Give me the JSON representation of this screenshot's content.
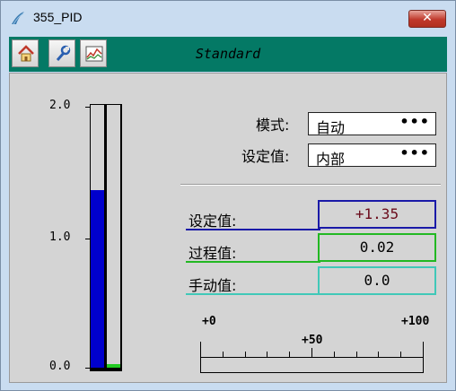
{
  "window": {
    "title": "355_PID",
    "close_label": "✕"
  },
  "toolbar": {
    "home_icon": "home-icon",
    "wrench_icon": "wrench-icon",
    "trend_icon": "trend-icon",
    "mode": "Standard"
  },
  "bargraph": {
    "max_label": "2.0",
    "mid_label": "1.0",
    "min_label": "0.0",
    "range": [
      0,
      2
    ],
    "setpoint": 1.35,
    "output": 0.0,
    "setpoint_color": "#0000cc",
    "output_color": "#22cc22"
  },
  "mode_row": {
    "label": "模式:",
    "value": "自动",
    "more": "•••"
  },
  "sp_source_row": {
    "label": "设定值:",
    "value": "内部",
    "more": "•••"
  },
  "values": {
    "setpoint": {
      "label": "设定值:",
      "value": "+1.35",
      "color": "#1a1aa8",
      "text_color": "#6a0a1a"
    },
    "process": {
      "label": "过程值:",
      "value": "0.02",
      "color": "#22b822"
    },
    "manual": {
      "label": "手动值:",
      "value": "0.0",
      "color": "#40c8b8"
    }
  },
  "scale": {
    "left_label": "+0",
    "mid_label": "+50",
    "right_label": "+100"
  }
}
